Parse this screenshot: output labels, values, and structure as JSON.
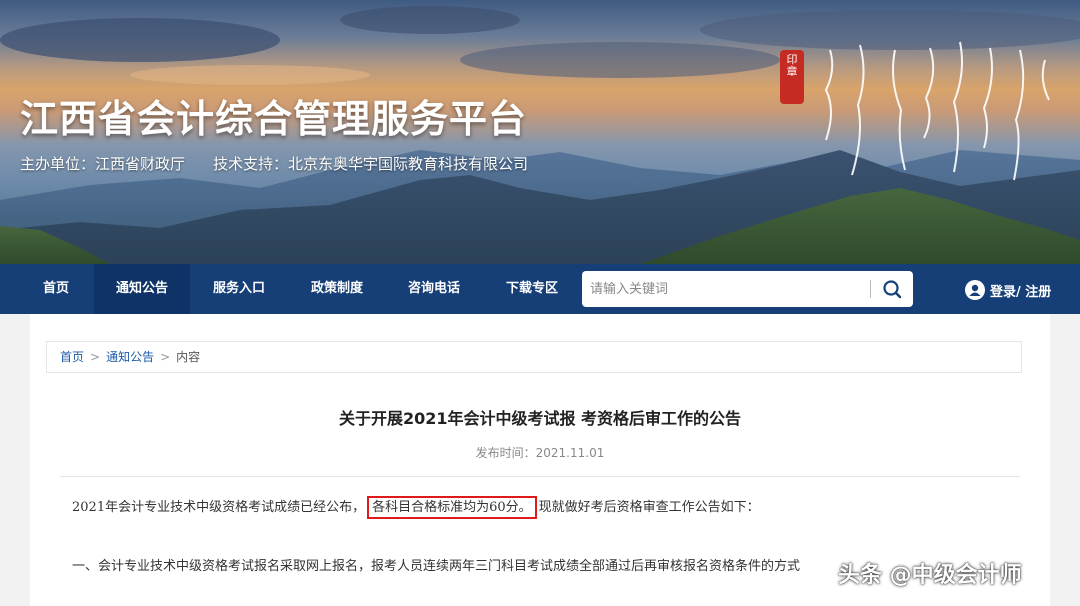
{
  "site": {
    "title": "江西省会计综合管理服务平台",
    "host": "主办单位：江西省财政厅",
    "support": "技术支持：北京东奥华宇国际教育科技有限公司"
  },
  "nav": {
    "items": [
      {
        "label": "首页"
      },
      {
        "label": "通知公告"
      },
      {
        "label": "服务入口"
      },
      {
        "label": "政策制度"
      },
      {
        "label": "咨询电话"
      },
      {
        "label": "下载专区"
      }
    ],
    "active_index": 1,
    "search_placeholder": "请输入关键词",
    "login_label": "登录/ 注册"
  },
  "breadcrumb": {
    "home": "首页",
    "section": "通知公告",
    "current": "内容",
    "sep": ">"
  },
  "article": {
    "title": "关于开展2021年会计中级考试报 考资格后审工作的公告",
    "date": "发布时间：2021.11.01",
    "para1_before": "2021年会计专业技术中级资格考试成绩已经公布，",
    "para1_highlight": "各科目合格标准均为60分。",
    "para1_after": "现就做好考后资格审查工作公告如下：",
    "para2": "一、会计专业技术中级资格考试报名采取网上报名，报考人员连续两年三门科目考试成绩全部通过后再审核报名资格条件的方式"
  },
  "watermark": "头条 @中级会计师",
  "colors": {
    "nav_bg": "#163f78",
    "nav_active": "#0f3366",
    "highlight_border": "#e01a1a",
    "link": "#1e5aa8"
  },
  "icons": [
    "search-icon",
    "user-icon"
  ]
}
